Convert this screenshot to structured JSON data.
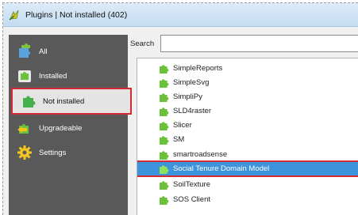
{
  "window": {
    "title": "Plugins | Not installed (402)"
  },
  "sidebar": {
    "items": [
      {
        "label": "All",
        "icon": "puzzle-all-icon"
      },
      {
        "label": "Installed",
        "icon": "puzzle-installed-icon"
      },
      {
        "label": "Not installed",
        "icon": "puzzle-not-installed-icon",
        "active": true
      },
      {
        "label": "Upgradeable",
        "icon": "puzzle-upgradeable-icon"
      },
      {
        "label": "Settings",
        "icon": "gear-icon"
      }
    ]
  },
  "search": {
    "label": "Search",
    "value": "",
    "placeholder": ""
  },
  "plugin_list": {
    "items": [
      "SimpleReports",
      "SimpleSvg",
      "SimpliPy",
      "SLD4raster",
      "Slicer",
      "SM",
      "smartroadsense",
      "Social Tenure Domain Model",
      "SoilTexture",
      "SOS Client"
    ],
    "selected_index": 7
  },
  "colors": {
    "sidebar_bg": "#595959",
    "highlight_border": "#d22b35",
    "selection_bg": "#3d94dd",
    "plugin_green": "#6cc13a"
  }
}
